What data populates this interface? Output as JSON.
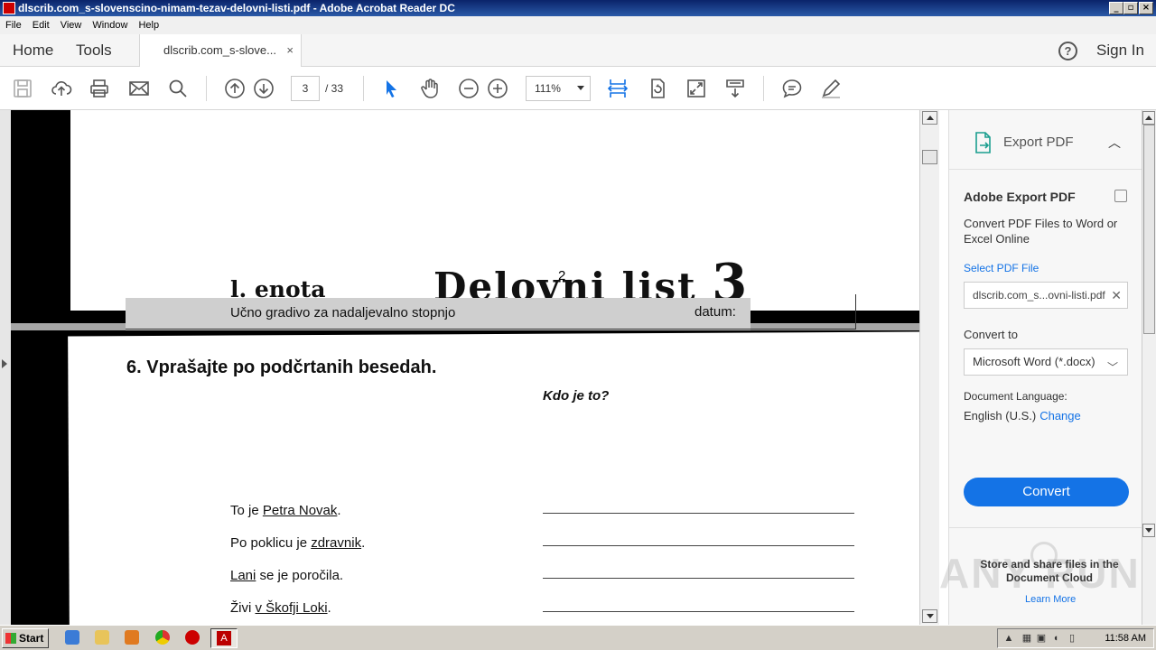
{
  "window": {
    "title": "dlscrib.com_s-slovenscino-nimam-tezav-delovni-listi.pdf - Adobe Acrobat Reader DC"
  },
  "menu": [
    "File",
    "Edit",
    "View",
    "Window",
    "Help"
  ],
  "tabs": {
    "home": "Home",
    "tools": "Tools",
    "document": "dlscrib.com_s-slove...",
    "close": "×"
  },
  "header": {
    "help": "?",
    "sign_in": "Sign In"
  },
  "toolbar": {
    "page_current": "3",
    "page_total": "/ 33",
    "zoom": "111%"
  },
  "pages": {
    "prev_page_number": "2",
    "unit": "l. enota",
    "worksheet": "Delovni list",
    "worksheet_number": "3",
    "subtitle": "Učno gradivo za nadaljevalno stopnjo",
    "datum": "datum:",
    "task": "6. Vprašajte po podčrtanih besedah.",
    "answer_example": "Kdo je to?",
    "sentences": [
      {
        "before": "To je ",
        "underlined": "Petra Novak",
        "after": "."
      },
      {
        "before": "Po poklicu je ",
        "underlined": "zdravnik",
        "after": "."
      },
      {
        "before": "",
        "underlined": "Lani",
        "after": " se je poročila."
      },
      {
        "before": "Živi ",
        "underlined": "v Škofji Loki",
        "after": "."
      }
    ]
  },
  "panel": {
    "header": "Export PDF",
    "section_title": "Adobe Export PDF",
    "description": "Convert PDF Files to Word or Excel Online",
    "select_link": "Select PDF File",
    "file_name": "dlscrib.com_s...ovni-listi.pdf",
    "convert_to_label": "Convert to",
    "format": "Microsoft Word (*.docx)",
    "language_label": "Document Language:",
    "language_value": "English (U.S.)",
    "language_change": "Change",
    "convert_button": "Convert",
    "store_text": "Store and share files in the Document Cloud",
    "learn_more": "Learn More"
  },
  "watermark": "ANY RUN",
  "taskbar": {
    "start": "Start",
    "clock": "11:58 AM"
  }
}
